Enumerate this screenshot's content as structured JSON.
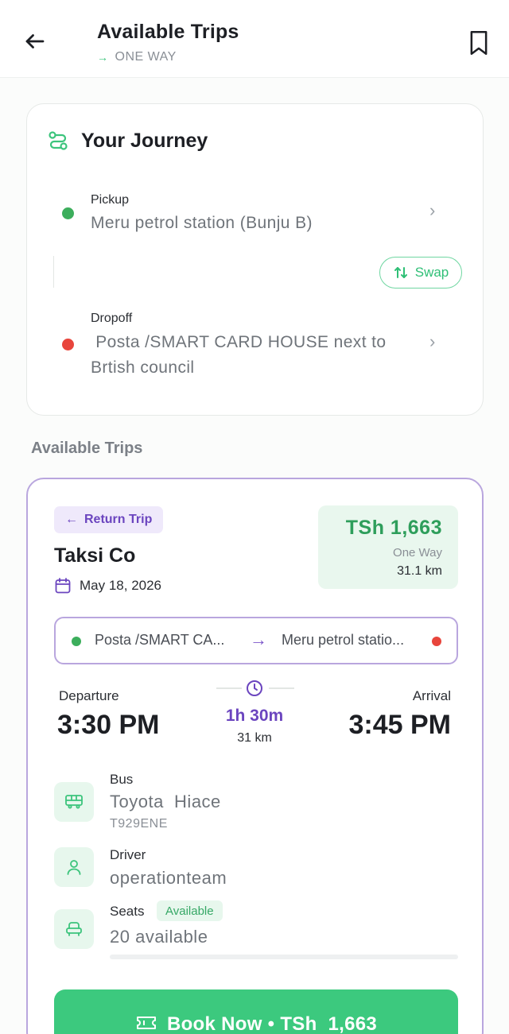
{
  "header": {
    "title": "Available Trips",
    "subtitle": "ONE WAY"
  },
  "journey": {
    "title": "Your Journey",
    "pickup": {
      "label": "Pickup",
      "value": "Meru petrol station (Bunju B)"
    },
    "dropoff": {
      "label": "Dropoff",
      "value": " Posta /SMART CARD HOUSE next to Brtish council"
    },
    "swap_label": "Swap"
  },
  "section_title": "Available Trips",
  "trip": {
    "badge": "Return Trip",
    "company": "Taksi Co",
    "date": "May 18, 2026",
    "price": "TSh  1,663",
    "trip_type": "One Way",
    "distance": "31.1 km",
    "route_from": "Posta /SMART CA...",
    "route_to": "Meru petrol statio...",
    "departure_label": "Departure",
    "departure_time": "3:30 PM",
    "arrival_label": "Arrival",
    "arrival_time": "3:45 PM",
    "duration": "1h 30m",
    "duration_km": "31 km",
    "bus_label": "Bus",
    "bus_value": "Toyota  Hiace",
    "plate": "T929ENE",
    "driver_label": "Driver",
    "driver_value": "operationteam",
    "seats_label": "Seats",
    "seats_badge": "Available",
    "seats_value": "20 available",
    "seats_fill_fraction": 0.0,
    "book_label": "Book Now • TSh  1,663"
  },
  "colors": {
    "accent_green": "#3cc97e",
    "accent_purple": "#6b45bf",
    "pickup_dot": "#3cae5c",
    "dropoff_dot": "#e8453c"
  },
  "icons": {
    "back": "arrow-left-icon",
    "bookmark": "bookmark-icon",
    "journey": "route-icon",
    "swap": "swap-vertical-icon",
    "calendar": "calendar-icon",
    "clock": "clock-icon",
    "bus": "bus-icon",
    "driver": "user-icon",
    "seats": "seat-icon",
    "ticket": "ticket-icon"
  }
}
